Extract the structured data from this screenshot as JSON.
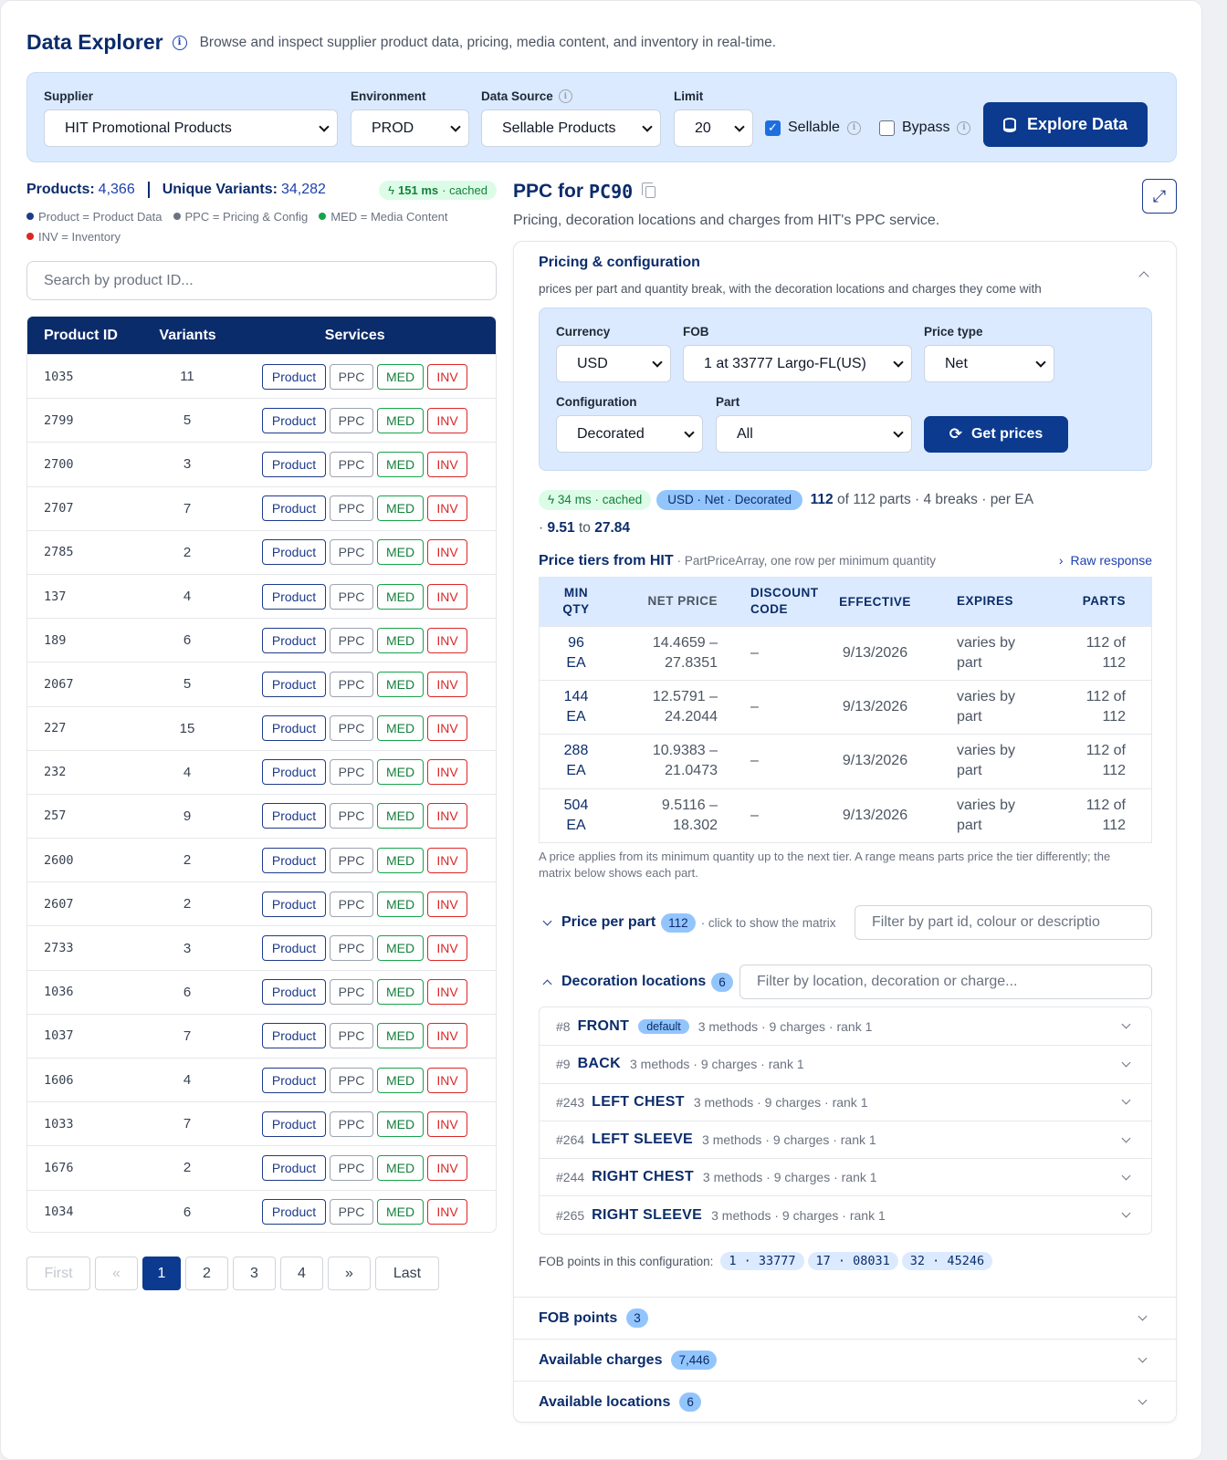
{
  "header": {
    "title": "Data Explorer",
    "description": "Browse and inspect supplier product data, pricing, media content, and inventory in real-time."
  },
  "filters": {
    "supplier_label": "Supplier",
    "supplier_value": "HIT Promotional Products",
    "environment_label": "Environment",
    "environment_value": "PROD",
    "datasource_label": "Data Source",
    "datasource_value": "Sellable Products",
    "limit_label": "Limit",
    "limit_value": "20",
    "sellable_label": "Sellable",
    "sellable_checked": true,
    "bypass_label": "Bypass",
    "bypass_checked": false,
    "explore_label": "Explore Data"
  },
  "stats": {
    "products_label": "Products:",
    "products_value": "4,366",
    "variants_label": "Unique Variants:",
    "variants_value": "34,282",
    "cache_ms": "151 ms",
    "cache_text": "· cached",
    "legend": [
      {
        "text": "Product = Product Data",
        "color": "#1e3a8a"
      },
      {
        "text": "PPC = Pricing & Config",
        "color": "#6b7280"
      },
      {
        "text": "MED = Media Content",
        "color": "#16a34a"
      },
      {
        "text": "INV = Inventory",
        "color": "#dc2626"
      }
    ]
  },
  "search": {
    "placeholder": "Search by product ID..."
  },
  "table": {
    "headers": [
      "Product ID",
      "Variants",
      "Services"
    ],
    "service_labels": [
      "Product",
      "PPC",
      "MED",
      "INV"
    ],
    "rows": [
      {
        "id": "1035",
        "variants": "11"
      },
      {
        "id": "2799",
        "variants": "5"
      },
      {
        "id": "2700",
        "variants": "3"
      },
      {
        "id": "2707",
        "variants": "7"
      },
      {
        "id": "2785",
        "variants": "2"
      },
      {
        "id": "137",
        "variants": "4"
      },
      {
        "id": "189",
        "variants": "6"
      },
      {
        "id": "2067",
        "variants": "5"
      },
      {
        "id": "227",
        "variants": "15"
      },
      {
        "id": "232",
        "variants": "4"
      },
      {
        "id": "257",
        "variants": "9"
      },
      {
        "id": "2600",
        "variants": "2"
      },
      {
        "id": "2607",
        "variants": "2"
      },
      {
        "id": "2733",
        "variants": "3"
      },
      {
        "id": "1036",
        "variants": "6"
      },
      {
        "id": "1037",
        "variants": "7"
      },
      {
        "id": "1606",
        "variants": "4"
      },
      {
        "id": "1033",
        "variants": "7"
      },
      {
        "id": "1676",
        "variants": "2"
      },
      {
        "id": "1034",
        "variants": "6"
      }
    ]
  },
  "pagination": {
    "first": "First",
    "prev": "«",
    "pages": [
      "1",
      "2",
      "3",
      "4"
    ],
    "current": "1",
    "next": "»",
    "last": "Last"
  },
  "detail": {
    "title_prefix": "PPC for",
    "product_code": "PC90",
    "subtitle": "Pricing, decoration locations and charges from HIT's PPC service.",
    "section_title": "Pricing & configuration",
    "section_sub": "prices per part and quantity break, with the decoration locations and charges they come with",
    "config": {
      "currency_label": "Currency",
      "currency_value": "USD",
      "fob_label": "FOB",
      "fob_value": "1 at 33777 Largo-FL(US)",
      "pricetype_label": "Price type",
      "pricetype_value": "Net",
      "configuration_label": "Configuration",
      "configuration_value": "Decorated",
      "part_label": "Part",
      "part_value": "All",
      "get_prices_label": "Get prices"
    },
    "meta": {
      "cache_ms": "34 ms",
      "cache_text": "· cached",
      "badge": "USD · Net · Decorated",
      "parts_shown": "112",
      "parts_text": "of 112 parts · 4 breaks · per EA",
      "range_prefix": "·",
      "range_low": "9.51",
      "range_to": "to",
      "range_high": "27.84"
    },
    "tiers": {
      "title": "Price tiers from HIT",
      "subtitle": "· PartPriceArray, one row per minimum quantity",
      "raw_label": "Raw response",
      "headers": [
        "MIN QTY",
        "NET PRICE",
        "DISCOUNT CODE",
        "EFFECTIVE",
        "EXPIRES",
        "PARTS"
      ],
      "rows": [
        {
          "qty": "96",
          "unit": "EA",
          "price1": "14.4659 –",
          "price2": "27.8351",
          "discount": "–",
          "effective": "9/13/2026",
          "expires1": "varies by",
          "expires2": "part",
          "parts1": "112 of",
          "parts2": "112"
        },
        {
          "qty": "144",
          "unit": "EA",
          "price1": "12.5791 –",
          "price2": "24.2044",
          "discount": "–",
          "effective": "9/13/2026",
          "expires1": "varies by",
          "expires2": "part",
          "parts1": "112 of",
          "parts2": "112"
        },
        {
          "qty": "288",
          "unit": "EA",
          "price1": "10.9383 –",
          "price2": "21.0473",
          "discount": "–",
          "effective": "9/13/2026",
          "expires1": "varies by",
          "expires2": "part",
          "parts1": "112 of",
          "parts2": "112"
        },
        {
          "qty": "504",
          "unit": "EA",
          "price1": "9.5116 –",
          "price2": "18.302",
          "discount": "–",
          "effective": "9/13/2026",
          "expires1": "varies by",
          "expires2": "part",
          "parts1": "112 of",
          "parts2": "112"
        }
      ],
      "note": "A price applies from its minimum quantity up to the next tier. A range means parts price the tier differently; the matrix below shows each part."
    },
    "price_per_part": {
      "title": "Price per part",
      "count": "112",
      "hint": "· click to show the matrix",
      "filter_placeholder": "Filter by part id, colour or descriptio"
    },
    "decoration": {
      "title": "Decoration locations",
      "count": "6",
      "filter_placeholder": "Filter by location, decoration or charge...",
      "locations": [
        {
          "id": "#8",
          "name": "FRONT",
          "badge": "default",
          "info": "3 methods · 9 charges · rank 1"
        },
        {
          "id": "#9",
          "name": "BACK",
          "badge": "",
          "info": "3 methods · 9 charges · rank 1"
        },
        {
          "id": "#243",
          "name": "LEFT CHEST",
          "badge": "",
          "info": "3 methods · 9 charges · rank 1"
        },
        {
          "id": "#264",
          "name": "LEFT SLEEVE",
          "badge": "",
          "info": "3 methods · 9 charges · rank 1"
        },
        {
          "id": "#244",
          "name": "RIGHT CHEST",
          "badge": "",
          "info": "3 methods · 9 charges · rank 1"
        },
        {
          "id": "#265",
          "name": "RIGHT SLEEVE",
          "badge": "",
          "info": "3 methods · 9 charges · rank 1"
        }
      ]
    },
    "fob_line": {
      "label": "FOB points in this configuration:",
      "points": [
        "1 · 33777",
        "17 · 08031",
        "32 · 45246"
      ]
    },
    "accordions": [
      {
        "title": "FOB points",
        "count": "3"
      },
      {
        "title": "Available charges",
        "count": "7,446"
      },
      {
        "title": "Available locations",
        "count": "6"
      }
    ]
  }
}
